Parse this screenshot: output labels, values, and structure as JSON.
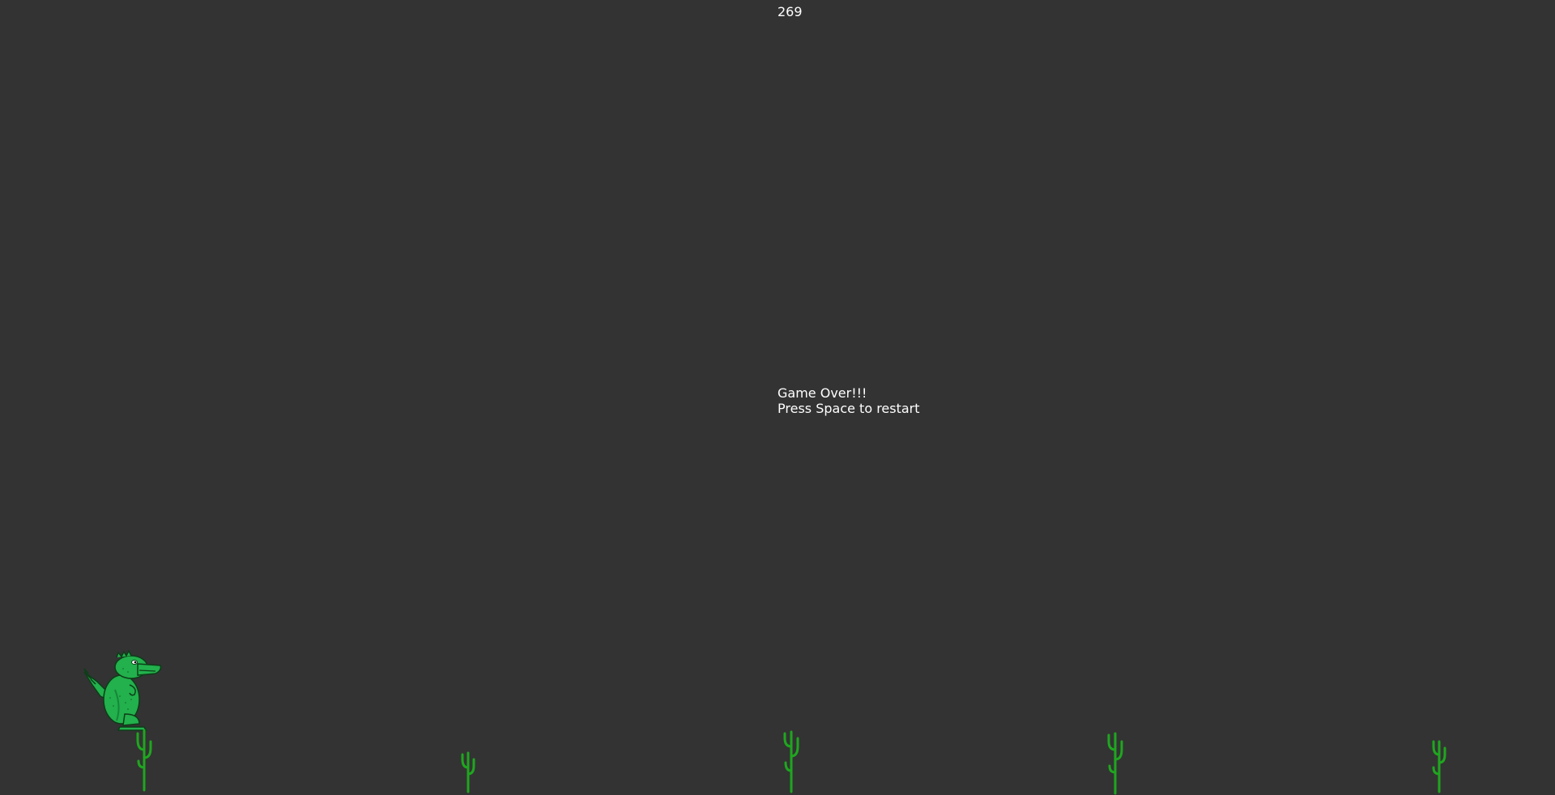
{
  "score": "269",
  "message": {
    "line1": "Game Over!!!",
    "line2": "Press Space to restart"
  },
  "colors": {
    "background": "#333333",
    "text": "#ffffff",
    "dino": "#22b14c",
    "cactus": "#1fa61f"
  },
  "sprites": {
    "player": "dinosaur-icon",
    "obstacle": "cactus-icon"
  }
}
